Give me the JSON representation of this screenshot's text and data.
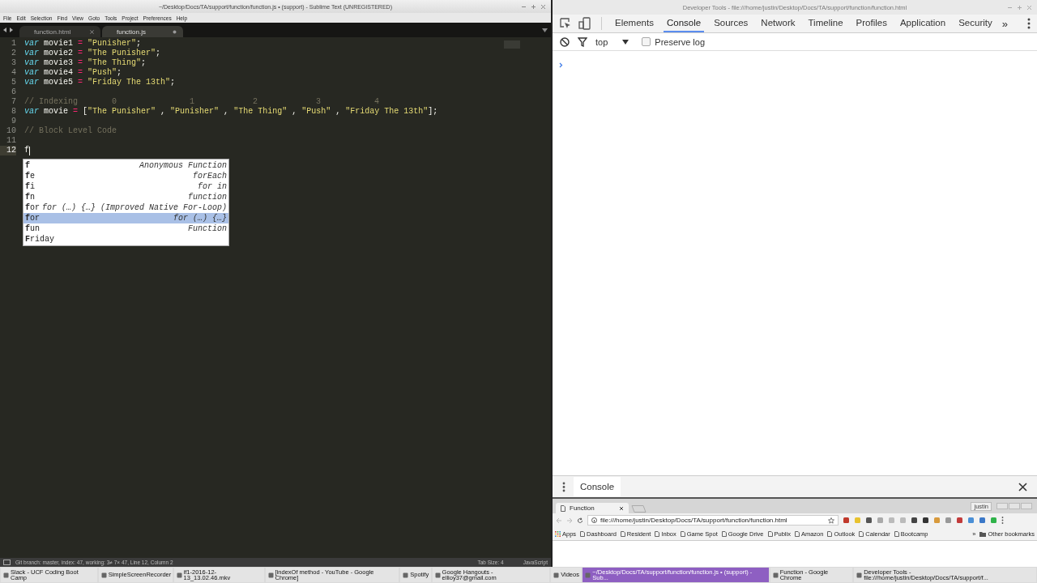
{
  "editor": {
    "title": "~/Desktop/Docs/TA/support/function/function.js • (support) - Sublime Text (UNREGISTERED)",
    "menu": [
      "File",
      "Edit",
      "Selection",
      "Find",
      "View",
      "Goto",
      "Tools",
      "Project",
      "Preferences",
      "Help"
    ],
    "tabs": [
      {
        "label": "function.html",
        "selected": false,
        "modified": false
      },
      {
        "label": "function.js",
        "selected": true,
        "modified": true
      }
    ],
    "lines": [
      {
        "number": "1",
        "current": false,
        "tokens": [
          {
            "kind": "kw",
            "text": "var"
          },
          {
            "kind": "id",
            "text": " movie1 "
          },
          {
            "kind": "op",
            "text": "= "
          },
          {
            "kind": "str",
            "text": "\"Punisher\""
          },
          {
            "kind": "id",
            "text": ";"
          }
        ]
      },
      {
        "number": "2",
        "current": false,
        "tokens": [
          {
            "kind": "kw",
            "text": "var"
          },
          {
            "kind": "id",
            "text": " movie2 "
          },
          {
            "kind": "op",
            "text": "= "
          },
          {
            "kind": "str",
            "text": "\"The Punisher\""
          },
          {
            "kind": "id",
            "text": ";"
          }
        ]
      },
      {
        "number": "3",
        "current": false,
        "tokens": [
          {
            "kind": "kw",
            "text": "var"
          },
          {
            "kind": "id",
            "text": " movie3 "
          },
          {
            "kind": "op",
            "text": "= "
          },
          {
            "kind": "str",
            "text": "\"The Thing\""
          },
          {
            "kind": "id",
            "text": ";"
          }
        ]
      },
      {
        "number": "4",
        "current": false,
        "tokens": [
          {
            "kind": "kw",
            "text": "var"
          },
          {
            "kind": "id",
            "text": " movie4 "
          },
          {
            "kind": "op",
            "text": "= "
          },
          {
            "kind": "str",
            "text": "\"Push\""
          },
          {
            "kind": "id",
            "text": ";"
          }
        ]
      },
      {
        "number": "5",
        "current": false,
        "tokens": [
          {
            "kind": "kw",
            "text": "var"
          },
          {
            "kind": "id",
            "text": " movie5 "
          },
          {
            "kind": "op",
            "text": "= "
          },
          {
            "kind": "str",
            "text": "\"Friday The 13th\""
          },
          {
            "kind": "id",
            "text": ";"
          }
        ]
      },
      {
        "number": "6",
        "current": false
      },
      {
        "number": "7",
        "current": false,
        "tokens": [
          {
            "kind": "cm",
            "text": "// Indexing       0               1            2            3           4"
          }
        ]
      },
      {
        "number": "8",
        "current": false,
        "tokens": [
          {
            "kind": "kw",
            "text": "var"
          },
          {
            "kind": "id",
            "text": " movie "
          },
          {
            "kind": "op",
            "text": "="
          },
          {
            "kind": "id",
            "text": " ["
          },
          {
            "kind": "str",
            "text": "\"The Punisher\""
          },
          {
            "kind": "id",
            "text": " , "
          },
          {
            "kind": "str",
            "text": "\"Punisher\""
          },
          {
            "kind": "id",
            "text": " , "
          },
          {
            "kind": "str",
            "text": "\"The Thing\""
          },
          {
            "kind": "id",
            "text": " , "
          },
          {
            "kind": "str",
            "text": "\"Push\""
          },
          {
            "kind": "id",
            "text": " , "
          },
          {
            "kind": "str",
            "text": "\"Friday The 13th\""
          },
          {
            "kind": "id",
            "text": "];"
          }
        ]
      },
      {
        "number": "9",
        "current": false
      },
      {
        "number": "10",
        "current": false,
        "tokens": [
          {
            "kind": "cm",
            "text": "// Block Level Code"
          }
        ]
      },
      {
        "number": "11",
        "current": false
      },
      {
        "number": "12",
        "current": true,
        "tokens": [
          {
            "kind": "id",
            "text": "f"
          }
        ]
      }
    ],
    "autocomplete": [
      {
        "trigger": "**f**",
        "hint": "Anonymous Function",
        "selected": false
      },
      {
        "trigger": "**f**e",
        "hint": "forEach",
        "selected": false
      },
      {
        "trigger": "**f**i",
        "hint": "for in",
        "selected": false
      },
      {
        "trigger": "**f**n",
        "hint": "function",
        "selected": false
      },
      {
        "trigger": "**f**or",
        "hint": "for (…) {…} (Improved Native For-Loop)",
        "selected": false
      },
      {
        "trigger": "**f**or",
        "hint": "for (…) {…}",
        "selected": true
      },
      {
        "trigger": "**f**un",
        "hint": "Function",
        "selected": false
      },
      {
        "trigger": "**F**riday",
        "selected": false
      }
    ],
    "status": {
      "text": "Git branch: master, index: 47, working: 3≠ 7× 47, Line 12, Column 2",
      "tab_size": "Tab Size: 4",
      "syntax": "JavaScript"
    }
  },
  "devtools": {
    "title": "Developer Tools - file:///home/justin/Desktop/Docs/TA/support/function/function.html",
    "tabs": [
      {
        "label": "Elements",
        "selected": false
      },
      {
        "label": "Console",
        "selected": true
      },
      {
        "label": "Sources",
        "selected": false
      },
      {
        "label": "Network",
        "selected": false
      },
      {
        "label": "Timeline",
        "selected": false
      },
      {
        "label": "Profiles",
        "selected": false
      },
      {
        "label": "Application",
        "selected": false
      },
      {
        "label": "Security",
        "selected": false
      }
    ],
    "more": "»",
    "context": "top",
    "preserve_log": {
      "label": "Preserve log",
      "checked": false
    },
    "drawer_tab": "Console"
  },
  "browser": {
    "tab": "Function",
    "profile": "justin",
    "url": "file:///home/justin/Desktop/Docs/TA/support/function/function.html",
    "bookmarks": [
      {
        "kind": "apps",
        "label": "Apps"
      },
      {
        "kind": "page",
        "label": "Dashboard"
      },
      {
        "kind": "page",
        "label": "Resident"
      },
      {
        "kind": "page",
        "label": "Inbox"
      },
      {
        "kind": "page",
        "label": "Game Spot"
      },
      {
        "kind": "page",
        "label": "Google Drive"
      },
      {
        "kind": "page",
        "label": "Publix"
      },
      {
        "kind": "page",
        "label": "Amazon"
      },
      {
        "kind": "page",
        "label": "Outlook"
      },
      {
        "kind": "page",
        "label": "Calendar"
      },
      {
        "kind": "page",
        "label": "Bootcamp"
      }
    ],
    "bookmarks_more": "»",
    "other_bookmarks": "Other bookmarks"
  },
  "taskbar": [
    {
      "label": "Slack - UCF Coding Boot Camp",
      "selected": false
    },
    {
      "label": "SimpleScreenRecorder",
      "selected": false
    },
    {
      "label": "if1-2016-12-13_13.02.46.mkv",
      "selected": false
    },
    {
      "label": "[indexOf method - YouTube - Google Chrome]",
      "selected": false
    },
    {
      "label": "Spotify",
      "selected": false
    },
    {
      "label": "Google Hangouts - ellioy37@gmail.com",
      "selected": false
    },
    {
      "label": "Videos",
      "selected": false
    },
    {
      "label": "~/Desktop/Docs/TA/support/function/function.js • (support) - Sub...",
      "selected": true
    },
    {
      "label": "Function - Google Chrome",
      "selected": false
    },
    {
      "label": "Developer Tools - file:///home/justin/Desktop/Docs/TA/support/f...",
      "selected": false
    }
  ]
}
